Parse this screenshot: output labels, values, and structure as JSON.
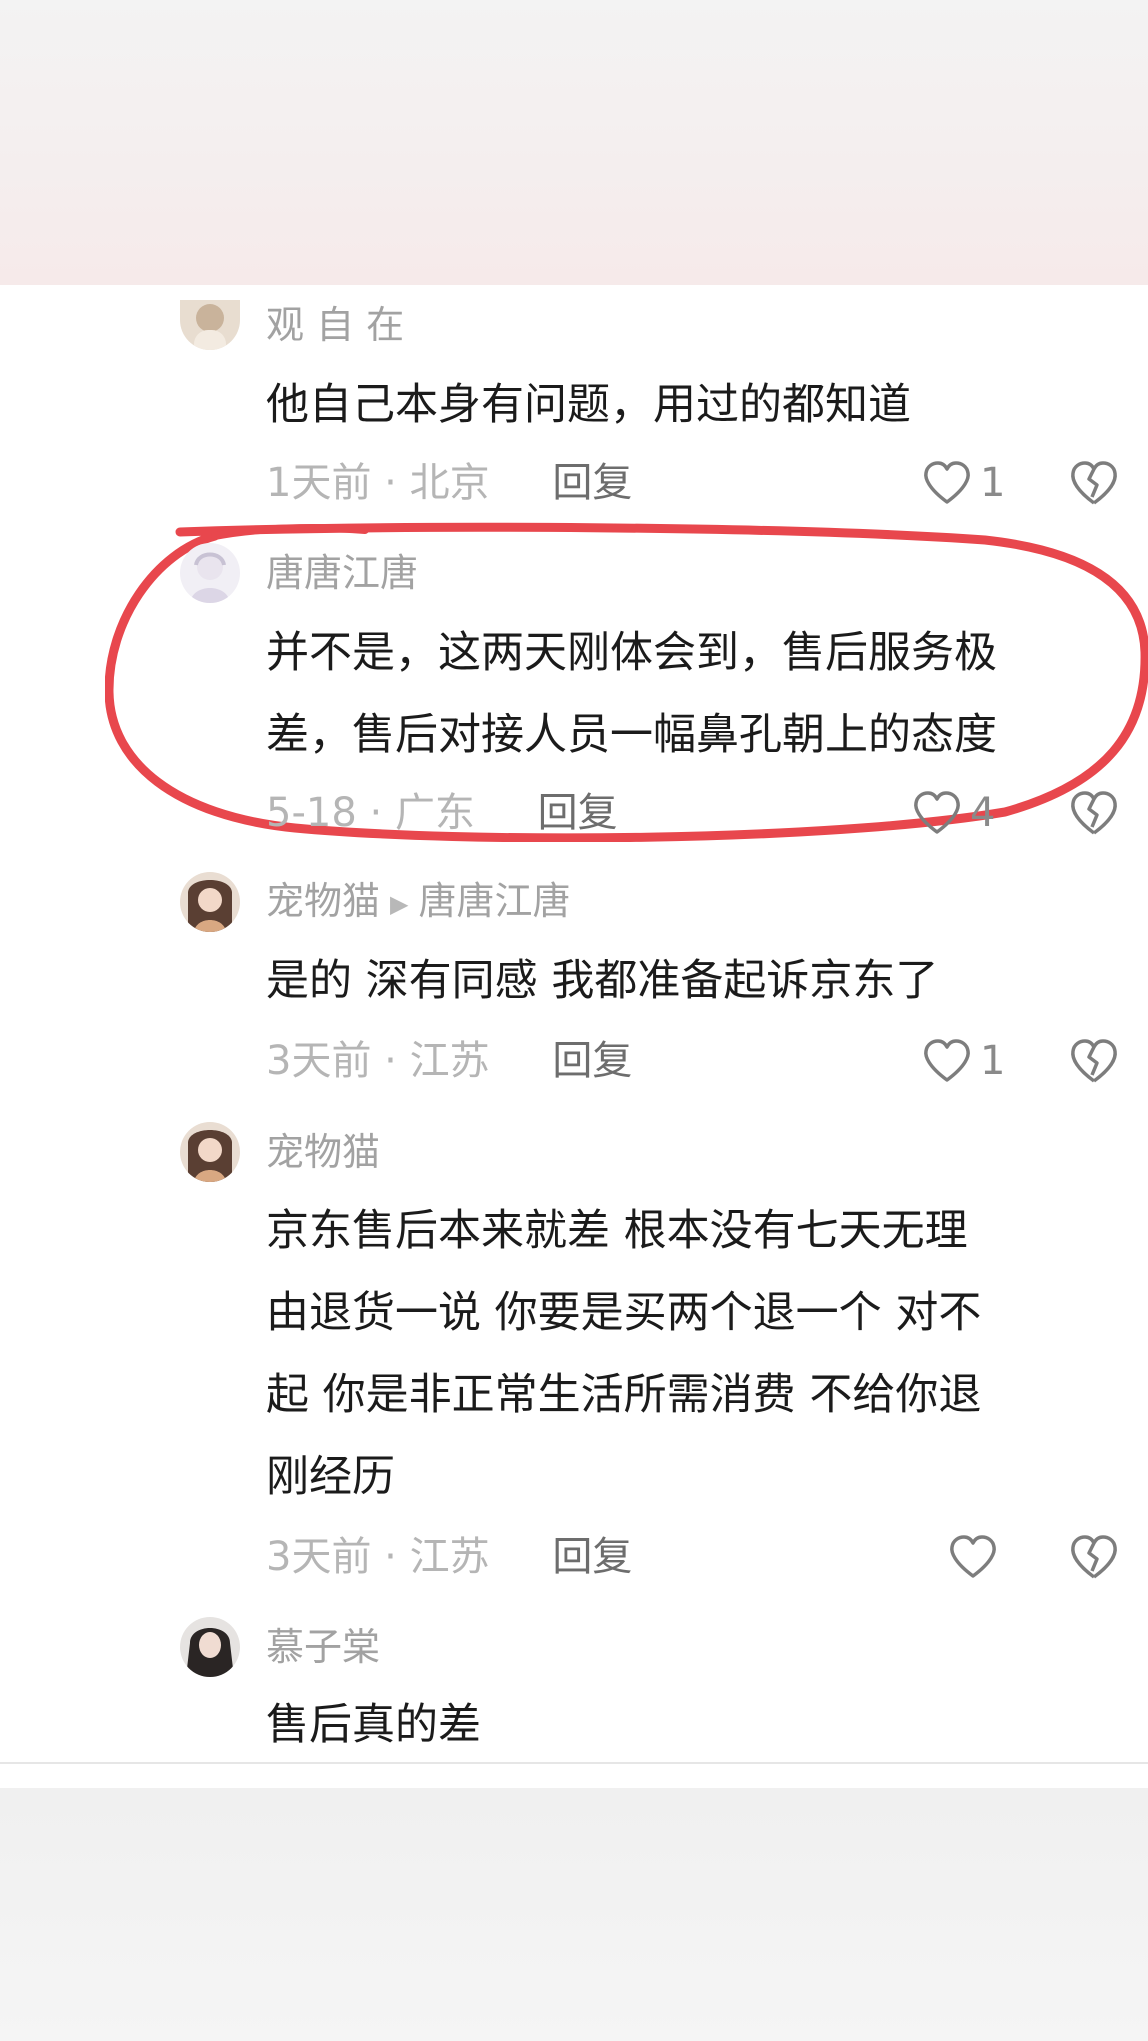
{
  "comments": [
    {
      "username": "观 自 在",
      "reply_to": "",
      "text_lines": [
        "他自己本身有问题，用过的都知道"
      ],
      "time": "1天前",
      "location": "北京",
      "reply_label": "回复",
      "likes": "1",
      "avatar_color": "#e5d9cc"
    },
    {
      "username": "唐唐江唐",
      "reply_to": "",
      "text_lines": [
        "并不是，这两天刚体会到，售后服务极",
        "差，售后对接人员一幅鼻孔朝上的态度"
      ],
      "time": "5-18",
      "location": "广东",
      "reply_label": "回复",
      "likes": "4",
      "avatar_color": "#eeebf3"
    },
    {
      "username": "宠物猫",
      "reply_to": "唐唐江唐",
      "text_lines": [
        "是的 深有同感 我都准备起诉京东了"
      ],
      "time": "3天前",
      "location": "江苏",
      "reply_label": "回复",
      "likes": "1",
      "avatar_color": "#9f7e6c"
    },
    {
      "username": "宠物猫",
      "reply_to": "",
      "text_lines": [
        "京东售后本来就差  根本没有七天无理",
        "由退货一说 你要是买两个退一个  对不",
        "起 你是非正常生活所需消费  不给你退",
        "刚经历"
      ],
      "time": "3天前",
      "location": "江苏",
      "reply_label": "回复",
      "likes": "",
      "avatar_color": "#9f7e6c"
    },
    {
      "username": "慕子棠",
      "reply_to": "",
      "text_lines": [
        "售后真的差"
      ],
      "avatar_color": "#2e2a2a"
    }
  ],
  "meta_separator": " · ",
  "highlight_color": "#e8474d"
}
